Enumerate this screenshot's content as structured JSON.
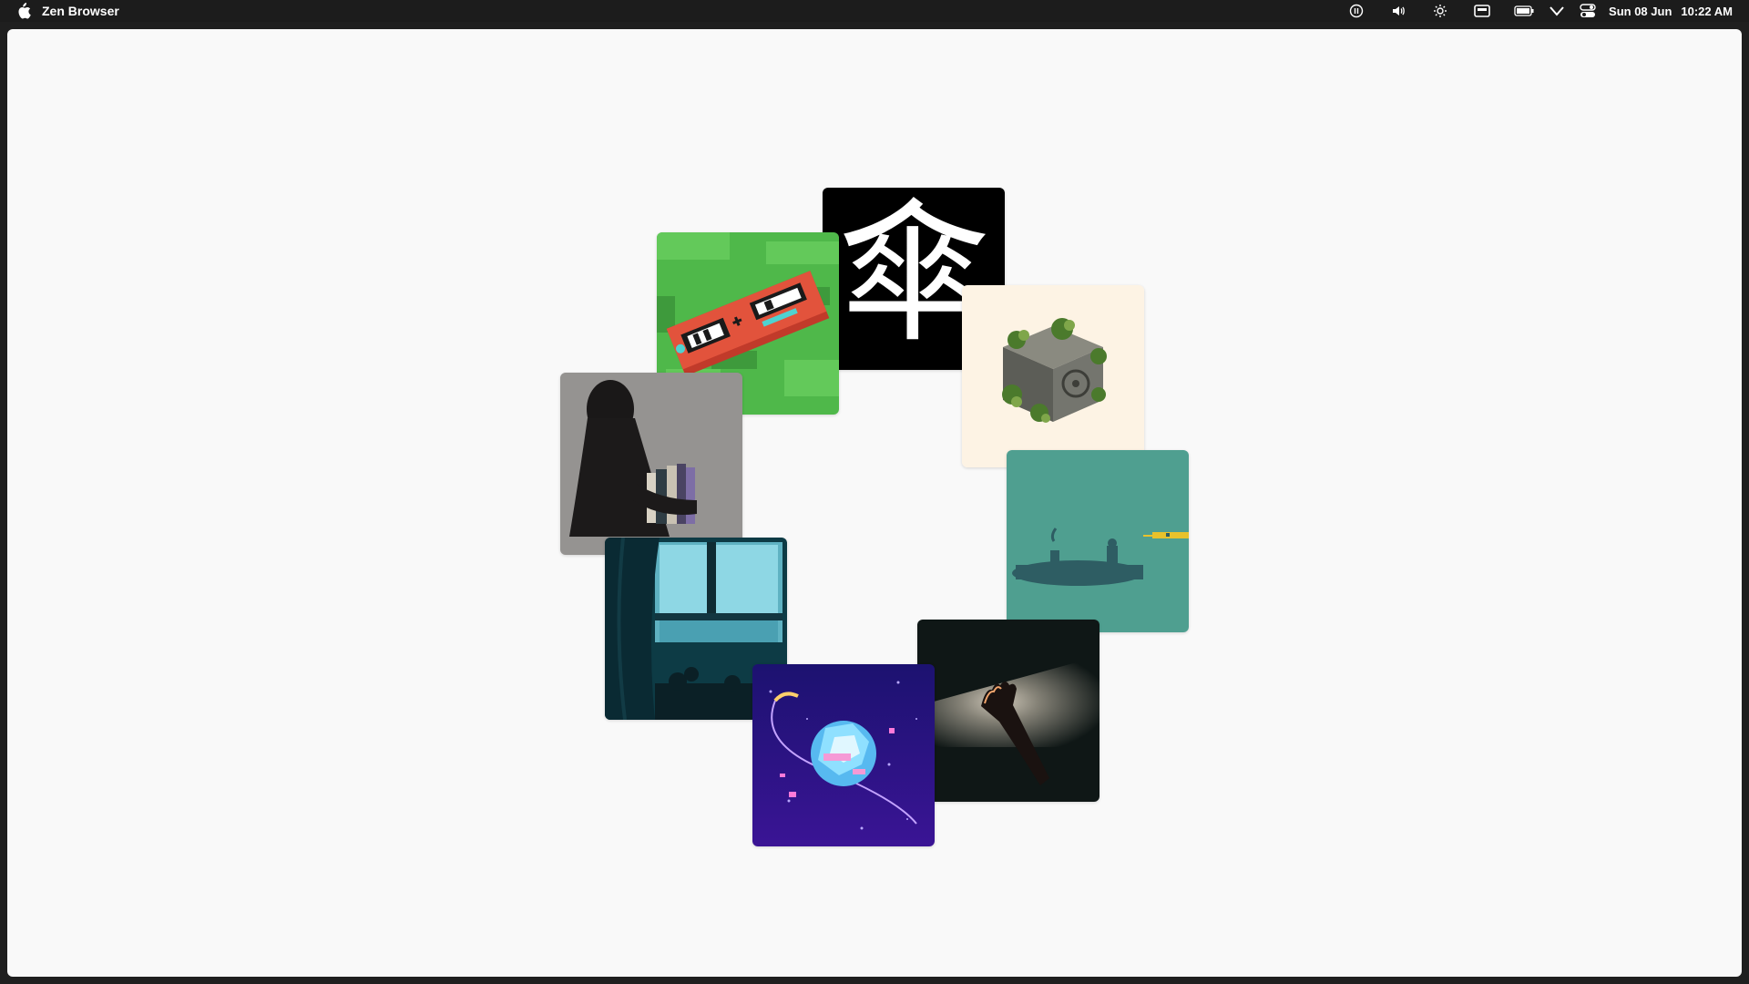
{
  "menubar": {
    "app_name": "Zen Browser",
    "date": "Sun 08 Jun",
    "time": "10:22 AM",
    "tray_icons": [
      "pause-icon",
      "volume-icon",
      "brightness-icon",
      "keyboard-icon",
      "battery-icon",
      "wifi-icon",
      "control-center-icon"
    ]
  },
  "gallery": {
    "cards": [
      {
        "name": "umbrella-kanji-artwork",
        "glyph": "傘",
        "bg": "#000000"
      },
      {
        "name": "pixel-gameboy-artwork",
        "bg": "#4fb84a"
      },
      {
        "name": "mossy-safe-artwork",
        "bg": "#fdf3e4"
      },
      {
        "name": "hooded-figure-books-photo",
        "bg": "#8e8c8a"
      },
      {
        "name": "submarine-pixel-artwork",
        "bg": "#4f9f90"
      },
      {
        "name": "teal-window-curtain-photo",
        "bg": "#0d3b45"
      },
      {
        "name": "glowing-hand-photo",
        "bg": "#0f1716"
      },
      {
        "name": "crystal-planet-artwork",
        "bg": "#1a0f62"
      }
    ]
  }
}
